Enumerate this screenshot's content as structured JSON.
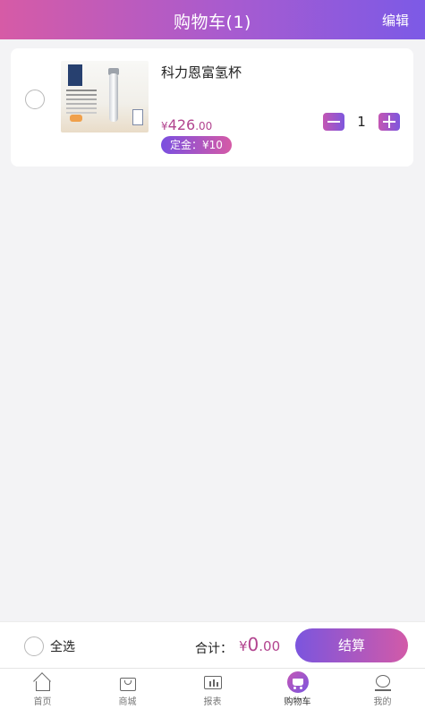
{
  "header": {
    "title": "购物车(1)",
    "edit_label": "编辑"
  },
  "cart": {
    "items": [
      {
        "name": "科力恩富氢杯",
        "price_symbol": "¥",
        "price_int": "426",
        "price_dec": ".00",
        "deposit_label": "定金：¥10",
        "quantity": "1",
        "checked": false
      }
    ]
  },
  "checkout": {
    "select_all_label": "全选",
    "total_label": "合计：",
    "total_symbol": "¥",
    "total_int": "0",
    "total_dec": ".00",
    "checkout_label": "结算"
  },
  "tabbar": {
    "items": [
      {
        "label": "首页",
        "icon": "home-icon",
        "active": false
      },
      {
        "label": "商城",
        "icon": "mall-icon",
        "active": false
      },
      {
        "label": "报表",
        "icon": "report-icon",
        "active": false
      },
      {
        "label": "购物车",
        "icon": "cart-icon",
        "active": true
      },
      {
        "label": "我的",
        "icon": "profile-icon",
        "active": false
      }
    ]
  },
  "colors": {
    "accent_pink": "#d65ba6",
    "accent_purple": "#7c5ae6",
    "price": "#b2448f",
    "background": "#f3f3f5"
  }
}
